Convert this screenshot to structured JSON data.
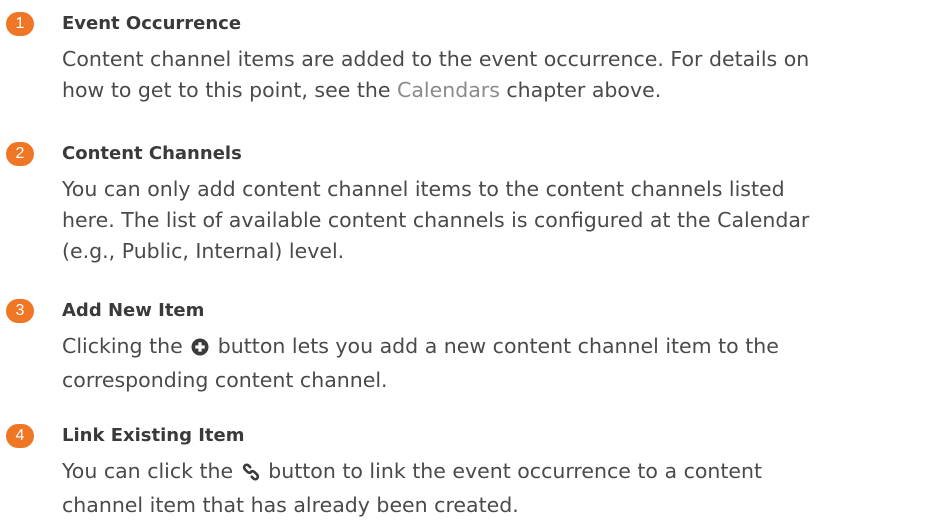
{
  "callouts": [
    {
      "number": "1",
      "title": "Event Occurrence",
      "lines": [
        {
          "before": "Content channel items are added to the event occurrence. For details on"
        },
        {
          "before": "how to get to this point, see the ",
          "link": "Calendars",
          "after": " chapter above."
        }
      ]
    },
    {
      "number": "2",
      "title": "Content Channels",
      "lines": [
        {
          "before": "You can only add content channel items to the content channels listed"
        },
        {
          "before": "here. The list of available content channels is configured at the Calendar"
        },
        {
          "before": "(e.g., Public, Internal) level."
        }
      ]
    },
    {
      "number": "3",
      "title": "Add New Item",
      "lines": [
        {
          "before": "Clicking the ",
          "icon": "plus-circle-icon",
          "after": " button lets you add a new content channel item to the"
        },
        {
          "before": "corresponding content channel."
        }
      ]
    },
    {
      "number": "4",
      "title": "Link Existing Item",
      "lines": [
        {
          "before": "You can click the ",
          "icon": "link-icon",
          "after": " button to link the event occurrence to a content"
        },
        {
          "before": "channel item that has already been created."
        }
      ]
    }
  ],
  "colors": {
    "badge": "#ee7624",
    "text": "#4a4a4a",
    "link": "#8a8a8a"
  }
}
